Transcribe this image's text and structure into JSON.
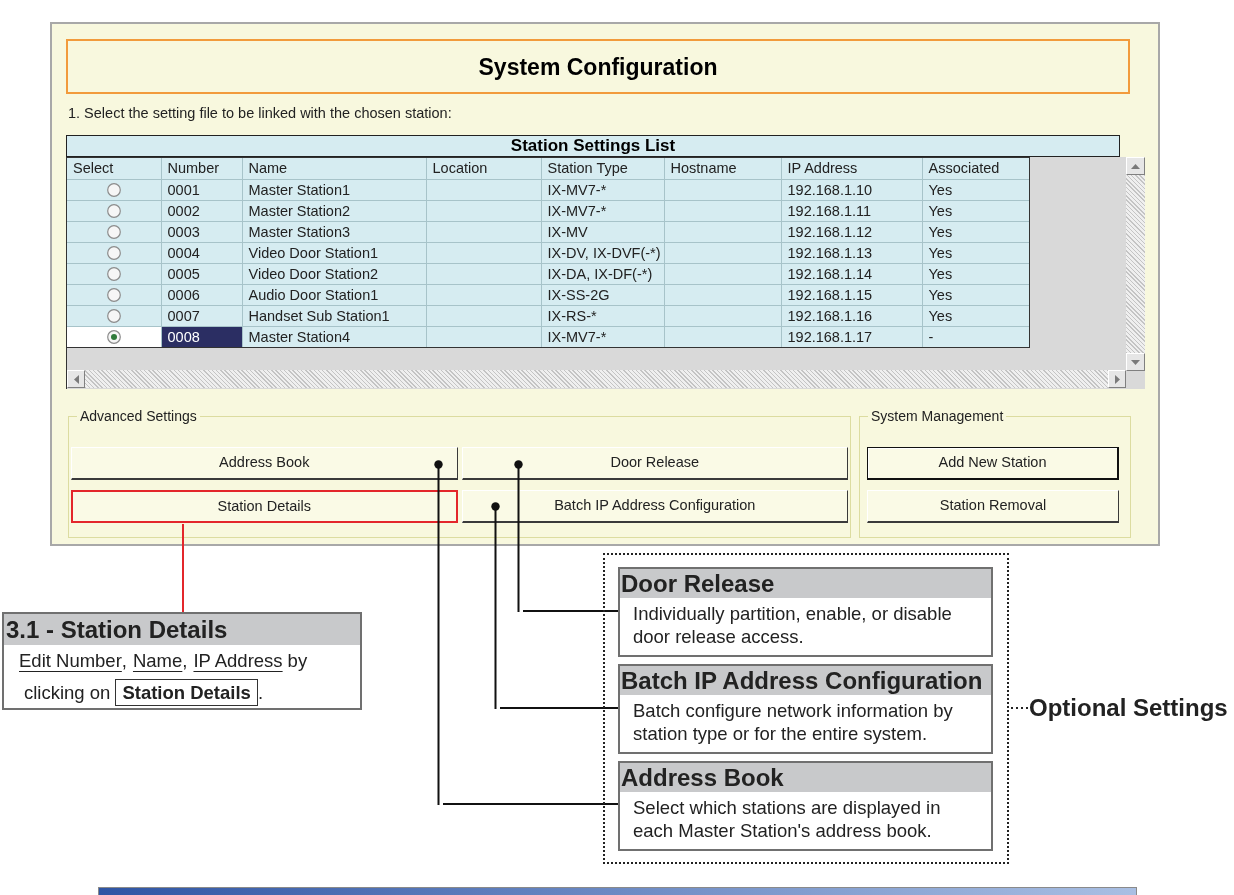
{
  "window": {
    "title": "System Configuration"
  },
  "instruction": "1. Select the setting file to be linked with the chosen station:",
  "station_list": {
    "title": "Station Settings List",
    "columns": [
      "Select",
      "Number",
      "Name",
      "Location",
      "Station Type",
      "Hostname",
      "IP Address",
      "Associated"
    ],
    "rows": [
      {
        "selected": false,
        "number": "0001",
        "name": "Master Station1",
        "station_type": "IX-MV7-*",
        "ip_address": "192.168.1.10",
        "associated": "Yes"
      },
      {
        "selected": false,
        "number": "0002",
        "name": "Master Station2",
        "station_type": "IX-MV7-*",
        "ip_address": "192.168.1.11",
        "associated": "Yes"
      },
      {
        "selected": false,
        "number": "0003",
        "name": "Master Station3",
        "station_type": "IX-MV",
        "ip_address": "192.168.1.12",
        "associated": "Yes"
      },
      {
        "selected": false,
        "number": "0004",
        "name": "Video Door Station1",
        "station_type": "IX-DV, IX-DVF(-*)",
        "ip_address": "192.168.1.13",
        "associated": "Yes"
      },
      {
        "selected": false,
        "number": "0005",
        "name": "Video Door Station2",
        "station_type": "IX-DA, IX-DF(-*)",
        "ip_address": "192.168.1.14",
        "associated": "Yes"
      },
      {
        "selected": false,
        "number": "0006",
        "name": "Audio Door Station1",
        "station_type": "IX-SS-2G",
        "ip_address": "192.168.1.15",
        "associated": "Yes"
      },
      {
        "selected": false,
        "number": "0007",
        "name": "Handset Sub Station1",
        "station_type": "IX-RS-*",
        "ip_address": "192.168.1.16",
        "associated": "Yes"
      },
      {
        "selected": true,
        "number": "0008",
        "name": "Master Station4",
        "station_type": "IX-MV7-*",
        "ip_address": "192.168.1.17",
        "associated": "-"
      }
    ]
  },
  "advanced_settings": {
    "label": "Advanced Settings",
    "buttons": [
      {
        "label": "Address Book",
        "highlighted": false
      },
      {
        "label": "Door Release",
        "highlighted": false
      },
      {
        "label": "Station Details",
        "highlighted": true
      },
      {
        "label": "Batch IP Address Configuration",
        "highlighted": false
      }
    ]
  },
  "system_management": {
    "label": "System Management",
    "buttons": [
      {
        "label": "Add New Station",
        "default": true
      },
      {
        "label": "Station Removal",
        "default": false
      }
    ]
  },
  "station_details_callout": {
    "title": "3.1 - Station Details",
    "lines": [
      [
        {
          "kind": "underlined",
          "text": "Edit Number"
        },
        {
          "kind": "punctuation",
          "text": ","
        },
        {
          "kind": "underlined",
          "text": "Name"
        },
        {
          "kind": "punctuation",
          "text": ","
        },
        {
          "kind": "underlined",
          "text": "IP Address"
        },
        {
          "kind": "plain",
          "text": "by"
        }
      ],
      [
        {
          "kind": "plain",
          "text": "clicking on"
        },
        {
          "kind": "button",
          "text": "Station Details"
        },
        {
          "kind": "punctuation",
          "text": "."
        }
      ]
    ]
  },
  "optional_settings": {
    "label": "Optional Settings",
    "callouts": [
      {
        "title": "Door Release",
        "lines": [
          "Individually partition, enable, or disable",
          "door release access."
        ]
      },
      {
        "title": "Batch IP Address Configuration",
        "lines": [
          "Batch configure network information by",
          "station type or for the entire system."
        ]
      },
      {
        "title": "Address Book",
        "lines": [
          "Select which stations are displayed in",
          "each Master Station's address book."
        ]
      }
    ]
  }
}
